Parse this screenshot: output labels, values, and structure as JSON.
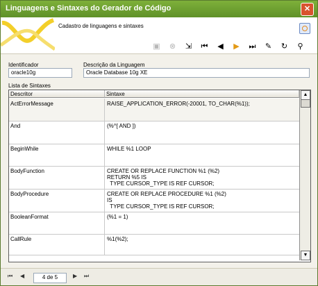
{
  "window": {
    "title": "Linguagens e Sintaxes do Gerador de Código",
    "close_glyph": "✕"
  },
  "header": {
    "subtitle": "Cadastro de linguagens e sintaxes"
  },
  "toolbar": [
    {
      "name": "save-icon",
      "glyph": "▣",
      "state": "disabled"
    },
    {
      "name": "cancel-icon",
      "glyph": "⊗",
      "state": "disabled"
    },
    {
      "name": "new-record-icon",
      "glyph": "⇲",
      "state": "enabled"
    },
    {
      "name": "first-record-icon",
      "glyph": "⏮",
      "state": "enabled"
    },
    {
      "name": "previous-record-icon",
      "glyph": "◀",
      "state": "enabled"
    },
    {
      "name": "next-record-icon",
      "glyph": "▶",
      "state": "enabled"
    },
    {
      "name": "last-record-icon",
      "glyph": "⏭",
      "state": "enabled"
    },
    {
      "name": "edit-icon",
      "glyph": "✎",
      "state": "enabled"
    },
    {
      "name": "refresh-icon",
      "glyph": "↻",
      "state": "enabled"
    },
    {
      "name": "search-icon",
      "glyph": "⚲",
      "state": "enabled"
    }
  ],
  "form": {
    "identificador_label": "Identificador",
    "identificador_value": "oracle10g",
    "descricao_label": "Descrição da Linguagem",
    "descricao_value": "Oracle Database 10g XE",
    "lista_label": "Lista de Sintaxes"
  },
  "grid": {
    "columns": [
      "Descritor",
      "Sintaxe"
    ],
    "rows": [
      {
        "descritor": "ActErrorMessage",
        "sintaxe": "RAISE_APPLICATION_ERROR(-20001, TO_CHAR(%1));"
      },
      {
        "descritor": "And",
        "sintaxe": "(%^[ AND ])"
      },
      {
        "descritor": "BeginWhile",
        "sintaxe": "WHILE %1 LOOP"
      },
      {
        "descritor": "BodyFunction",
        "sintaxe": "CREATE OR REPLACE FUNCTION %1 (%2)\nRETURN %5 IS\n  TYPE CURSOR_TYPE IS REF CURSOR;"
      },
      {
        "descritor": "BodyProcedure",
        "sintaxe": "CREATE OR REPLACE PROCEDURE %1 (%2)\nIS\n  TYPE CURSOR_TYPE IS REF CURSOR;"
      },
      {
        "descritor": "BooleanFormat",
        "sintaxe": "(%1 = 1)"
      },
      {
        "descritor": "CallRule",
        "sintaxe": "%1(%2);"
      }
    ],
    "selected_row": 0,
    "scroll_up_glyph": "▲",
    "scroll_down_glyph": "▼"
  },
  "navigator": {
    "first": "⏮",
    "previous": "◀",
    "counter": "4 de 5",
    "next": "▶",
    "last": "⏭"
  },
  "colors": {
    "titlebar": "#6da232",
    "selection": "#f5f4ef",
    "accent": "#e39a16"
  }
}
